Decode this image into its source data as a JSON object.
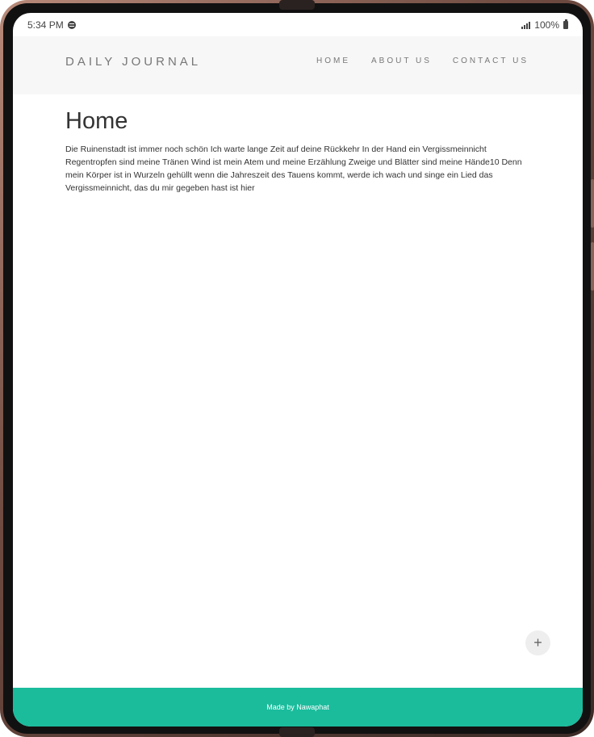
{
  "status_bar": {
    "time": "5:34 PM",
    "battery": "100%"
  },
  "header": {
    "brand": "DAILY JOURNAL",
    "nav": [
      "HOME",
      "ABOUT US",
      "CONTACT US"
    ]
  },
  "main": {
    "title": "Home",
    "body": "Die Ruinenstadt ist immer noch schön Ich warte lange Zeit auf deine Rückkehr In der Hand ein Vergissmeinnicht Regentropfen sind meine Tränen Wind ist mein Atem und meine Erzählung Zweige und Blätter sind meine Hände10 Denn mein Körper ist in Wurzeln gehüllt wenn die Jahreszeit des Tauens kommt, werde ich wach und singe ein Lied das Vergissmeinnicht, das du mir gegeben hast ist hier"
  },
  "fab": {
    "label": "+"
  },
  "footer": {
    "text": "Made by Nawaphat"
  },
  "colors": {
    "accent": "#1abc9c",
    "navbar_bg": "#f7f7f7"
  },
  "icons": [
    "spotify-icon",
    "signal-icon",
    "battery-icon",
    "plus-icon"
  ]
}
